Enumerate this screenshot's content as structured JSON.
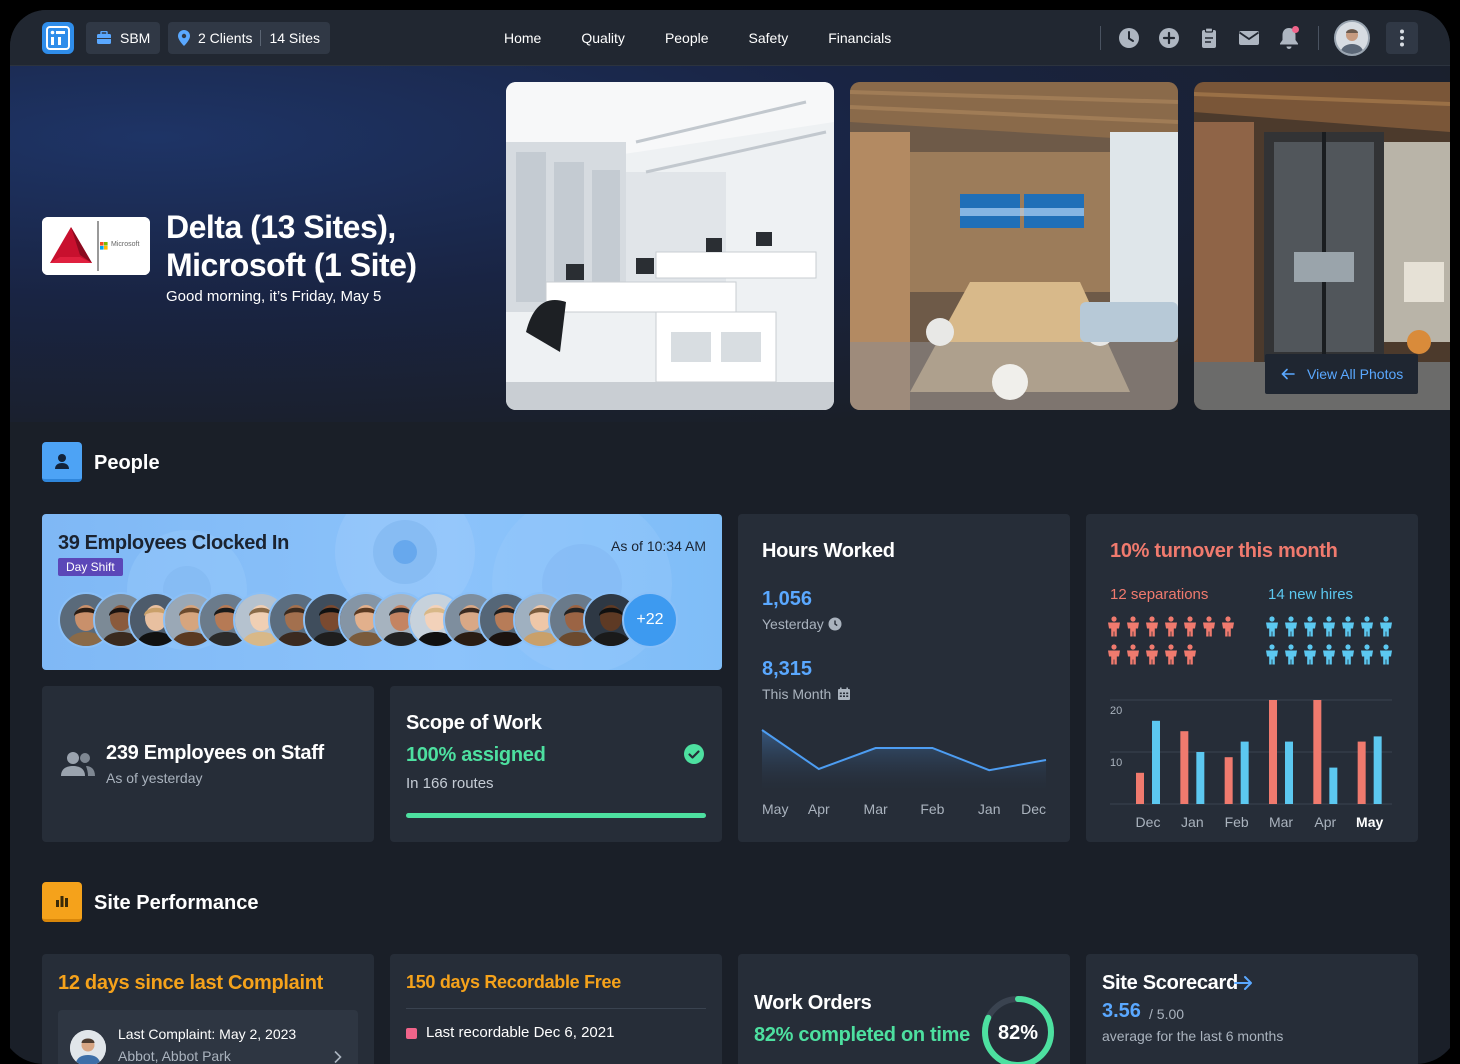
{
  "topbar": {
    "org": "SBM",
    "clients": "2 Clients",
    "sites": "14 Sites",
    "nav": [
      "Home",
      "Quality",
      "People",
      "Safety",
      "Financials"
    ],
    "icons": [
      "clock-icon",
      "plus-circle-icon",
      "clipboard-icon",
      "mail-icon",
      "bell-icon"
    ]
  },
  "hero": {
    "title": "Delta (13 Sites), Microsoft (1 Site)",
    "greeting": "Good morning, it’s Friday, May 5",
    "logo_text": "Microsoft",
    "view_photos": "View All Photos"
  },
  "people": {
    "section_title": "People",
    "clocked": {
      "title": "39 Employees Clocked In",
      "shift": "Day Shift",
      "as_of": "As of 10:34 AM",
      "more": "+22"
    },
    "staff": {
      "title": "239 Employees on Staff",
      "sub": "As of yesterday"
    },
    "scope": {
      "title": "Scope of Work",
      "assigned": "100% assigned",
      "routes": "In 166 routes",
      "progress": 1.0
    },
    "hours": {
      "title": "Hours Worked",
      "yesterday_value": "1,056",
      "yesterday_label": "Yesterday",
      "month_value": "8,315",
      "month_label": "This Month",
      "axis": [
        "May",
        "Apr",
        "Mar",
        "Feb",
        "Jan",
        "Dec"
      ]
    },
    "turnover": {
      "title": "10% turnover this month",
      "separations_label": "12 separations",
      "hires_label": "14 new hires",
      "separations": 12,
      "hires": 14,
      "colors": {
        "separations": "#f07a6e",
        "hires": "#5cc8f0"
      }
    }
  },
  "site_performance": {
    "section_title": "Site Performance",
    "complaint": {
      "title": "12 days since last Complaint",
      "last": "Last Complaint: May 2, 2023",
      "location": "Abbot, Abbot Park"
    },
    "recordable": {
      "title": "150 days Recordable Free",
      "last": "Last recordable Dec 6, 2021"
    },
    "work_orders": {
      "title": "Work Orders",
      "completed": "82% completed on time",
      "percent_label": "82%",
      "percent": 0.82
    },
    "scorecard": {
      "title": "Site Scorecard",
      "score": "3.56",
      "max": "/ 5.00",
      "sub": "average for the last 6 months"
    }
  },
  "chart_data": [
    {
      "type": "area",
      "title": "Hours Worked",
      "categories": [
        "May",
        "Apr",
        "Mar",
        "Feb",
        "Jan",
        "Dec"
      ],
      "values": [
        1.0,
        0.35,
        0.7,
        0.7,
        0.33,
        0.5
      ],
      "xlabel": "",
      "ylabel": ""
    },
    {
      "type": "bar",
      "title": "",
      "categories": [
        "Dec",
        "Jan",
        "Feb",
        "Mar",
        "Apr",
        "May"
      ],
      "ylim": [
        0,
        20
      ],
      "yticks": [
        "20",
        "10"
      ],
      "series": [
        {
          "name": "separations",
          "color": "#f07a6e",
          "values": [
            6,
            14,
            9,
            20,
            20,
            12
          ]
        },
        {
          "name": "hires",
          "color": "#5cc8f0",
          "values": [
            16,
            10,
            12,
            12,
            7,
            13
          ]
        }
      ]
    }
  ]
}
